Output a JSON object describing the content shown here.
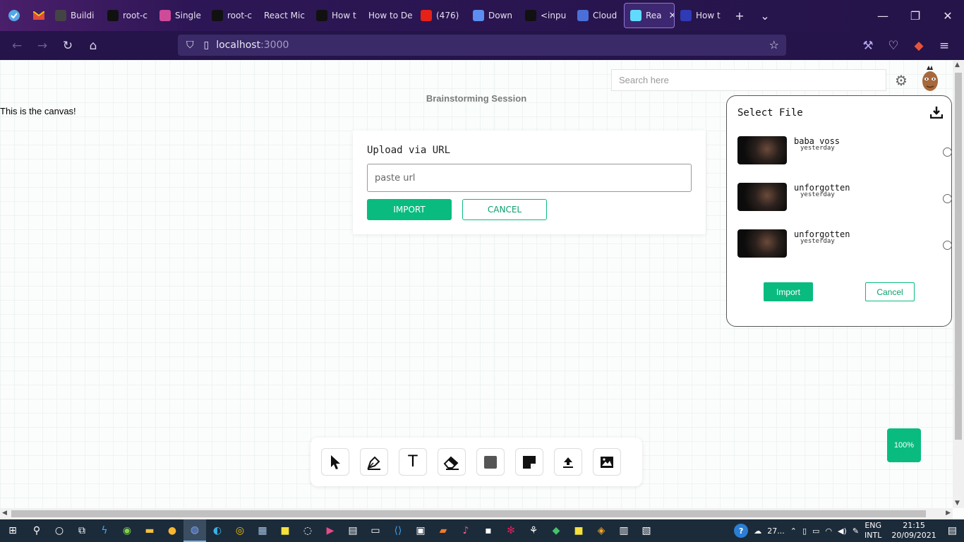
{
  "browser": {
    "tabs": [
      {
        "label": "",
        "icon": "mail-icon",
        "color": "#e04a3b"
      },
      {
        "label": "Buildi",
        "icon": "chevron-left-icon",
        "color": "#444"
      },
      {
        "label": "root-c",
        "icon": "github-icon",
        "color": "#111"
      },
      {
        "label": "Single",
        "icon": "single-spa-icon",
        "color": "#d04a9a"
      },
      {
        "label": "root-c",
        "icon": "github-icon",
        "color": "#111"
      },
      {
        "label": "React Mic",
        "icon": "",
        "color": ""
      },
      {
        "label": "How t",
        "icon": "medium-icon",
        "color": "#111"
      },
      {
        "label": "How to De",
        "icon": "",
        "color": ""
      },
      {
        "label": "(476)",
        "icon": "youtube-icon",
        "color": "#e62117"
      },
      {
        "label": "Down",
        "icon": "flag-icon",
        "color": "#5b8ef0"
      },
      {
        "label": "<inpu",
        "icon": "mdn-icon",
        "color": "#111"
      },
      {
        "label": "Cloud",
        "icon": "cloud-icon",
        "color": "#4a6fd8"
      },
      {
        "label": "Rea",
        "icon": "react-icon",
        "color": "#61dafb",
        "active": true
      },
      {
        "label": "How t",
        "icon": "js-icon",
        "color": "#2f3ab5"
      }
    ],
    "url_host": "localhost",
    "url_port": ":3000"
  },
  "page": {
    "search_placeholder": "Search here",
    "title": "Brainstorming Session",
    "canvas_text": "This is the canvas!",
    "zoom_label": "100%"
  },
  "upload_dialog": {
    "heading": "Upload via URL",
    "placeholder": "paste url",
    "import_label": "IMPORT",
    "cancel_label": "CANCEL"
  },
  "file_panel": {
    "heading": "Select File",
    "files": [
      {
        "name": "baba voss",
        "date": "yesterday"
      },
      {
        "name": "unforgotten",
        "date": "yesterday"
      },
      {
        "name": "unforgotten",
        "date": "yesterday"
      }
    ],
    "import_label": "Import",
    "cancel_label": "Cancel"
  },
  "toolbar": {
    "tools": [
      "select-tool",
      "pen-tool",
      "text-tool",
      "eraser-tool",
      "shape-tool",
      "sticky-note-tool",
      "upload-tool",
      "image-tool"
    ],
    "text_tool_glyph": "T"
  },
  "taskbar": {
    "weather": "27...",
    "lang_top": "ENG",
    "lang_bottom": "INTL",
    "time": "21:15",
    "date": "20/09/2021"
  },
  "colors": {
    "accent": "#0abb7f",
    "browser_bg": "#241449"
  }
}
